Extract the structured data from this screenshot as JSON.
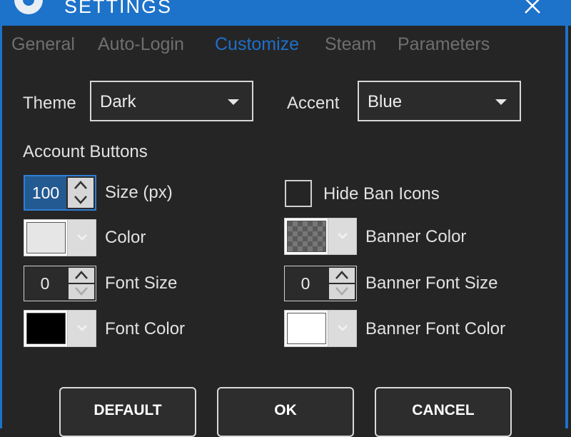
{
  "window": {
    "title": "SETTINGS"
  },
  "tabs": [
    {
      "label": "General"
    },
    {
      "label": "Auto-Login"
    },
    {
      "label": "Customize",
      "active": true
    },
    {
      "label": "Steam"
    },
    {
      "label": "Parameters"
    }
  ],
  "theme": {
    "label": "Theme",
    "value": "Dark"
  },
  "accent": {
    "label": "Accent",
    "value": "Blue"
  },
  "account_buttons": {
    "heading": "Account Buttons",
    "size": {
      "label": "Size (px)",
      "value": "100"
    },
    "color": {
      "label": "Color",
      "swatch": "#e6e6e6"
    },
    "font_size": {
      "label": "Font Size",
      "value": "0"
    },
    "font_color": {
      "label": "Font Color",
      "swatch": "#000000"
    },
    "hide_ban_icons": {
      "label": "Hide Ban Icons",
      "checked": false
    },
    "banner_color": {
      "label": "Banner Color",
      "swatch": "transparent"
    },
    "banner_font_size": {
      "label": "Banner Font Size",
      "value": "0"
    },
    "banner_font_color": {
      "label": "Banner Font Color",
      "swatch": "#ffffff"
    }
  },
  "buttons": {
    "default": "DEFAULT",
    "ok": "OK",
    "cancel": "CANCEL"
  },
  "colors": {
    "accent": "#1d72c9",
    "background": "#252525"
  }
}
